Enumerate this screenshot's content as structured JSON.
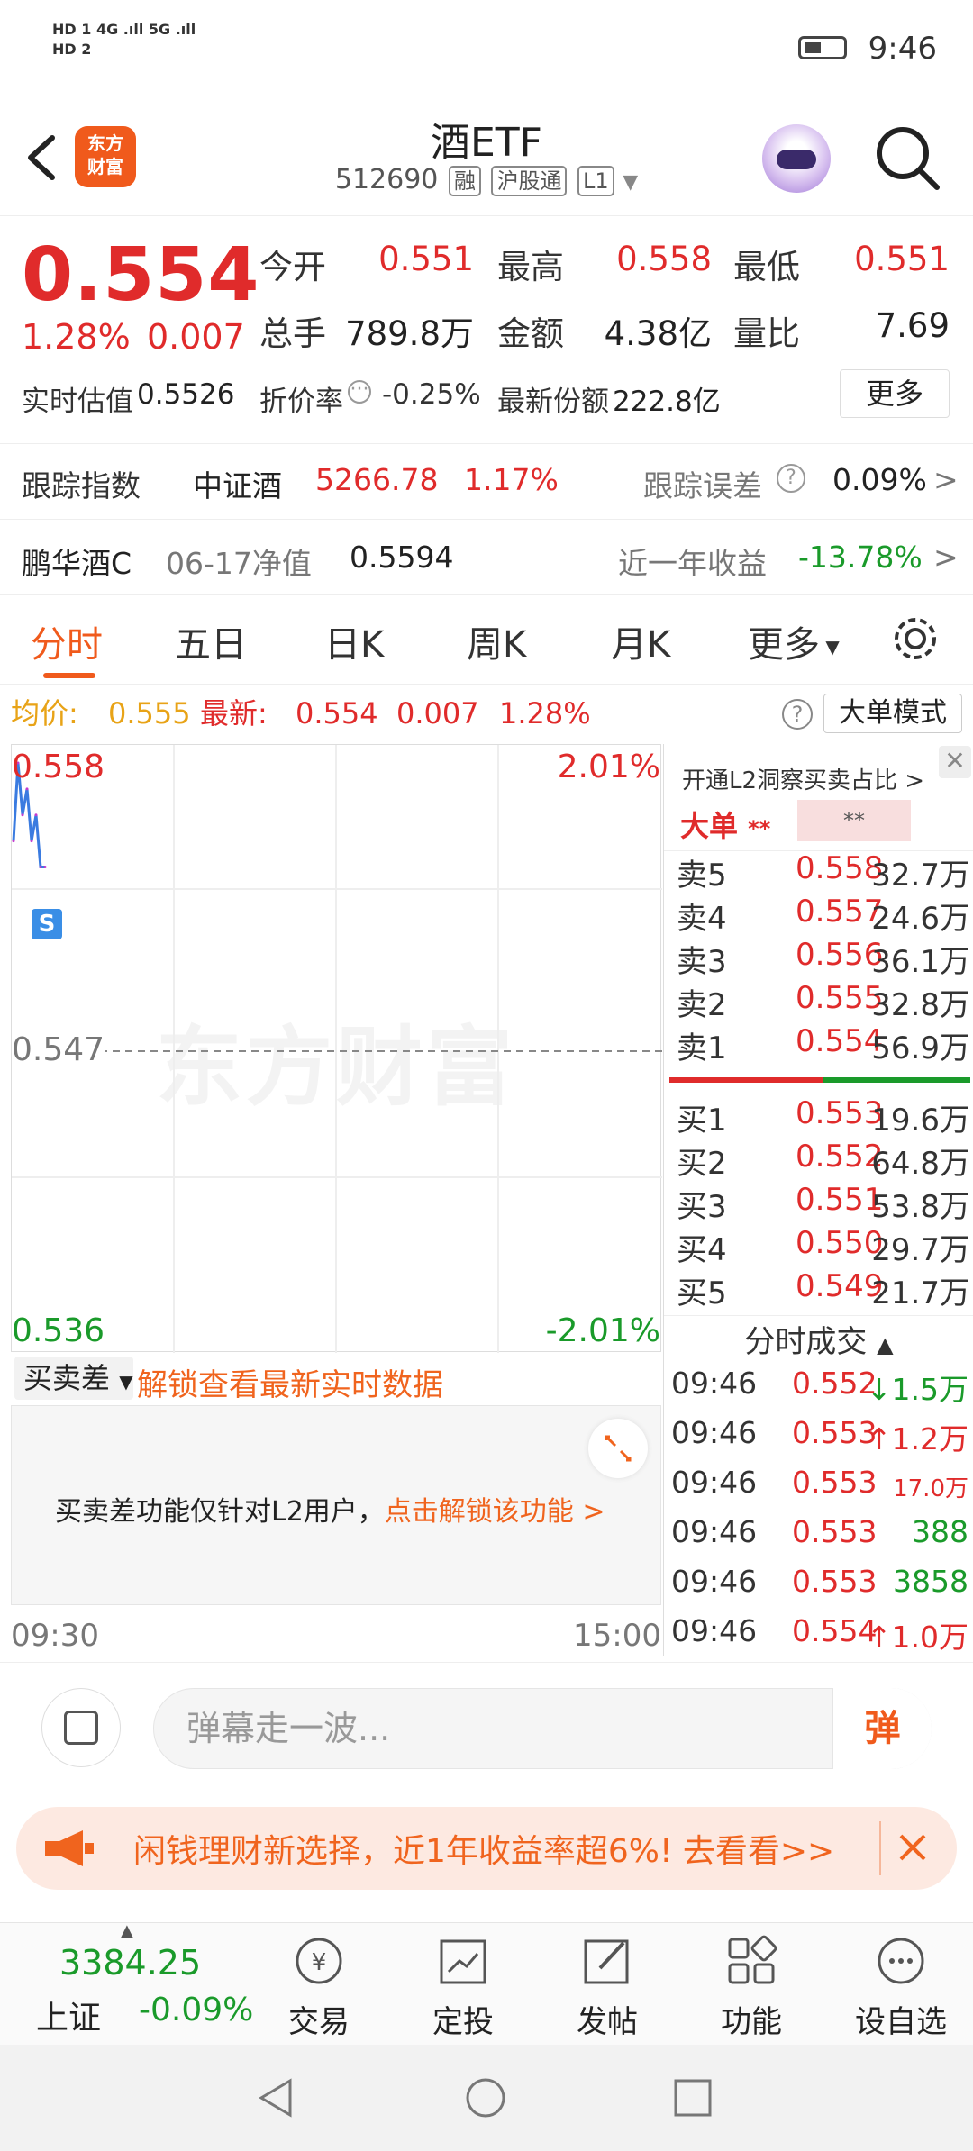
{
  "status": {
    "time": "9:46",
    "sig_left": "HD 1 4G\nHD 2 5G"
  },
  "header": {
    "logo": "东方财富",
    "title": "酒ETF",
    "code": "512690",
    "tags": [
      "融",
      "沪股通",
      "L1"
    ]
  },
  "quote": {
    "price": "0.554",
    "pct": "1.28%",
    "chg": "0.007",
    "open_label": "今开",
    "open": "0.551",
    "high_label": "最高",
    "high": "0.558",
    "low_label": "最低",
    "low": "0.551",
    "vol_label": "总手",
    "vol": "789.8万",
    "amount_label": "金额",
    "amount": "4.38亿",
    "ratio_label": "量比",
    "ratio": "7.69",
    "est_label": "实时估值",
    "est": "0.5526",
    "disc_label": "折价率",
    "disc": "-0.25%",
    "share_label": "最新份额",
    "share": "222.8亿",
    "more": "更多"
  },
  "track": {
    "label": "跟踪指数",
    "index": "中证酒",
    "value": "5266.78",
    "pct": "1.17%",
    "err_label": "跟踪误差",
    "err": "0.09%"
  },
  "fund": {
    "name": "鹏华酒C",
    "nav_label": "06-17净值",
    "nav": "0.5594",
    "ret_label": "近一年收益",
    "ret": "-13.78%"
  },
  "tabs": [
    "分时",
    "五日",
    "日K",
    "周K",
    "月K",
    "更多"
  ],
  "avg": {
    "avg_label": "均价:",
    "avg": "0.555",
    "new_label": "最新:",
    "new": "0.554",
    "chg": "0.007",
    "pct": "1.28%",
    "mode": "大单模式"
  },
  "chart": {
    "top_price": "0.558",
    "top_pct": "2.01%",
    "mid_price": "0.547",
    "bot_price": "0.536",
    "bot_pct": "-2.01%",
    "watermark": "东方财富",
    "marker": "S",
    "time_start": "09:30",
    "time_end": "15:00"
  },
  "chart_data": {
    "type": "line",
    "title": "",
    "xlabel": "",
    "ylabel": "",
    "ylim": [
      0.536,
      0.558
    ],
    "x": [
      "09:30",
      "09:31",
      "09:32",
      "09:33",
      "09:34",
      "09:35",
      "09:36",
      "09:37"
    ],
    "series": [
      {
        "name": "",
        "values": [
          0.555,
          0.558,
          0.556,
          0.557,
          0.555,
          0.556,
          0.554,
          0.554
        ]
      }
    ]
  },
  "orderbook": {
    "l2": "开通L2洞察买卖占比",
    "big": "大单",
    "stars": "**",
    "asks": [
      {
        "label": "卖5",
        "price": "0.558",
        "vol": "32.7万"
      },
      {
        "label": "卖4",
        "price": "0.557",
        "vol": "24.6万"
      },
      {
        "label": "卖3",
        "price": "0.556",
        "vol": "36.1万"
      },
      {
        "label": "卖2",
        "price": "0.555",
        "vol": "32.8万"
      },
      {
        "label": "卖1",
        "price": "0.554",
        "vol": "56.9万"
      }
    ],
    "bids": [
      {
        "label": "买1",
        "price": "0.553",
        "vol": "19.6万"
      },
      {
        "label": "买2",
        "price": "0.552",
        "vol": "64.8万"
      },
      {
        "label": "买3",
        "price": "0.551",
        "vol": "53.8万"
      },
      {
        "label": "买4",
        "price": "0.550",
        "vol": "29.7万"
      },
      {
        "label": "买5",
        "price": "0.549",
        "vol": "21.7万"
      }
    ],
    "trades_title": "分时成交",
    "trades": [
      {
        "t": "09:46",
        "p": "0.552",
        "v": "↓1.5万",
        "c": "#1a9a2a"
      },
      {
        "t": "09:46",
        "p": "0.553",
        "v": "↑1.2万",
        "c": "#e02b2b"
      },
      {
        "t": "09:46",
        "p": "0.553",
        "v": "17.0万",
        "c": "#e02b2b"
      },
      {
        "t": "09:46",
        "p": "0.553",
        "v": "388",
        "c": "#1a9a2a"
      },
      {
        "t": "09:46",
        "p": "0.553",
        "v": "3858",
        "c": "#1a9a2a"
      },
      {
        "t": "09:46",
        "p": "0.554",
        "v": "↑1.0万",
        "c": "#e02b2b"
      }
    ]
  },
  "spread": {
    "select": "买卖差",
    "link": "解锁查看最新实时数据",
    "msg": "买卖差功能仅针对L2用户，",
    "msg_link": "点击解锁该功能 >"
  },
  "danmu": {
    "placeholder": "弹幕走一波...",
    "btn": "弹"
  },
  "ad": {
    "text": "闲钱理财新选择，近1年收益率超6%! 去看看>>"
  },
  "bottom": {
    "index_value": "3384.25",
    "index_name": "上证",
    "index_pct": "-0.09%",
    "items": [
      "交易",
      "定投",
      "发帖",
      "功能",
      "设自选"
    ]
  }
}
